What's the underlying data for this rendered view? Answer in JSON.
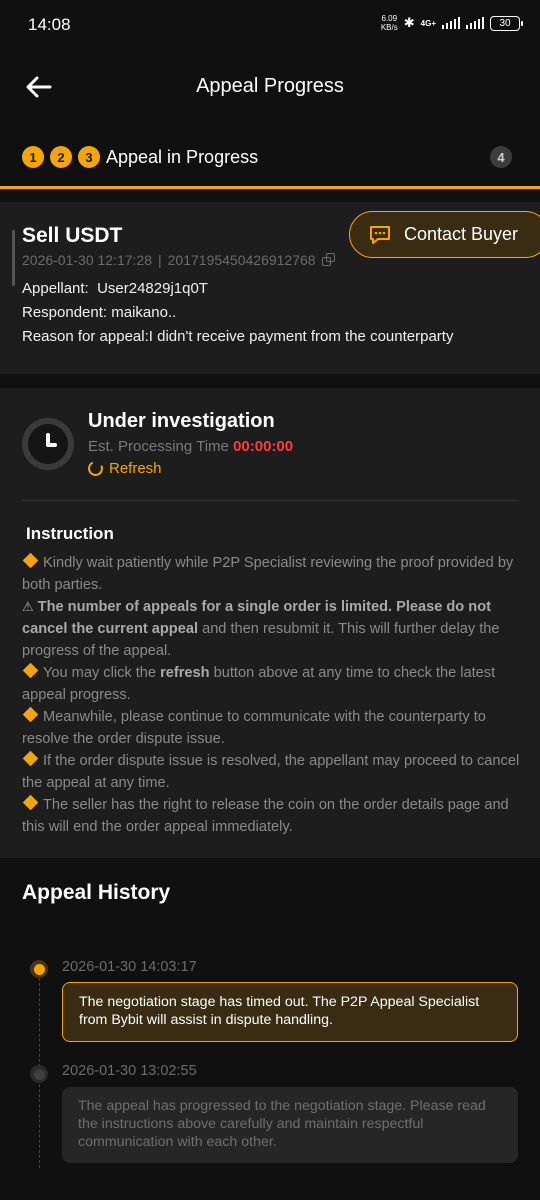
{
  "status_bar": {
    "time": "14:08",
    "net_speed_value": "6.09",
    "net_speed_unit": "KB/s",
    "network": "4G+",
    "battery": "30"
  },
  "header": {
    "title": "Appeal Progress"
  },
  "stepper": {
    "steps_done": [
      "1",
      "2",
      "3"
    ],
    "current_label": "Appeal in Progress",
    "next_step": "4"
  },
  "order": {
    "title": "Sell USDT",
    "datetime": "2026-01-30 12:17:28",
    "separator": "|",
    "order_id": "2017195450426912768",
    "appellant_label": "Appellant:",
    "appellant": "User24829j1q0T",
    "respondent_label": "Respondent:",
    "respondent": "maikano..",
    "reason_label": "Reason for appeal:",
    "reason": "I didn't receive payment from the counterparty",
    "contact_label": "Contact Buyer"
  },
  "investigation": {
    "title": "Under investigation",
    "eta_label": "Est. Processing Time",
    "eta_value": "00:00:00",
    "refresh_label": "Refresh"
  },
  "instruction": {
    "title": "Instruction",
    "item1": "Kindly wait patiently while P2P Specialist reviewing the proof provided by both parties.",
    "warning_bold": "The number of appeals for a single order is limited. Please do not cancel the current appeal",
    "warning_rest": "and then resubmit it. This will further delay the progress of the appeal.",
    "item3_pre": "You may click the",
    "item3_bold": "refresh",
    "item3_post": "button above at any time to check the latest appeal progress.",
    "item4": "Meanwhile, please continue to communicate with the counterparty to resolve the order dispute issue.",
    "item5": "If the order dispute issue is resolved, the appellant may proceed to cancel the appeal at any time.",
    "item6": "The seller has the right to release the coin on the order details page and this will end the order appeal immediately."
  },
  "history": {
    "title": "Appeal History",
    "events": [
      {
        "time": "2026-01-30 14:03:17",
        "text": "The negotiation stage has timed out. The P2P Appeal Specialist from Bybit will assist in dispute handling."
      },
      {
        "time": "2026-01-30 13:02:55",
        "text": "The appeal has progressed to the negotiation stage. Please read the instructions above carefully and maintain respectful communication with each other."
      }
    ]
  },
  "colors": {
    "accent": "#f7a600",
    "timer": "#ff3b3b",
    "background": "#101010",
    "card": "#1d1d1d"
  },
  "icons": [
    "back-arrow-icon",
    "bluetooth-icon",
    "signal-icon",
    "battery-icon",
    "copy-icon",
    "chat-icon",
    "clock-icon",
    "refresh-icon",
    "diamond-bullet-icon",
    "warning-icon"
  ]
}
